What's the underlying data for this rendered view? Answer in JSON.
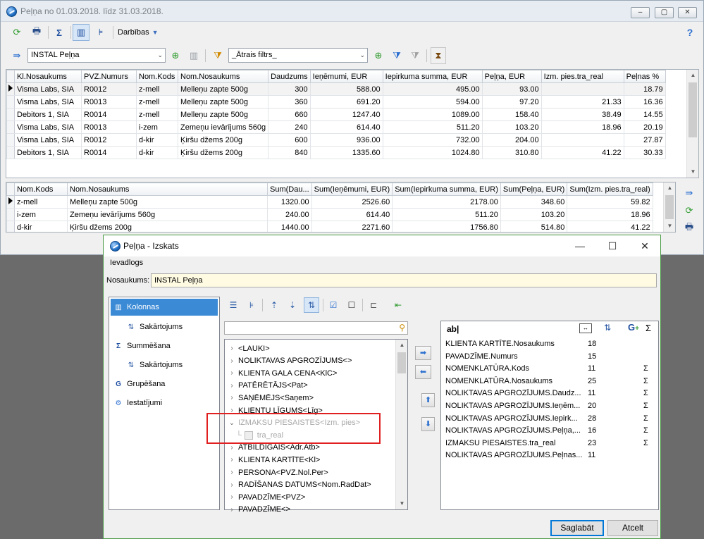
{
  "main_window": {
    "title": "Peļņa no 01.03.2018. līdz 31.03.2018.",
    "toolbar": {
      "actions_label": "Darbības",
      "help_label": "?"
    },
    "view_combo": {
      "value": "INSTAL Peļņa"
    },
    "filter_combo": {
      "value": "_Ātrais filtrs_"
    },
    "detail_grid": {
      "columns": [
        "Kl.Nosaukums",
        "PVZ.Numurs",
        "Nom.Kods",
        "Nom.Nosaukums",
        "Daudzums",
        "Ieņēmumi, EUR",
        "Iepirkuma summa, EUR",
        "Peļņa, EUR",
        "Izm. pies.tra_real",
        "Peļnas %"
      ],
      "rows": [
        [
          "Visma Labs, SIA",
          "R0012",
          "z-mell",
          "Melleņu zapte 500g",
          "300",
          "588.00",
          "495.00",
          "93.00",
          "",
          "18.79"
        ],
        [
          "Visma Labs, SIA",
          "R0013",
          "z-mell",
          "Melleņu zapte 500g",
          "360",
          "691.20",
          "594.00",
          "97.20",
          "21.33",
          "16.36"
        ],
        [
          "Debitors 1, SIA",
          "R0014",
          "z-mell",
          "Melleņu zapte 500g",
          "660",
          "1247.40",
          "1089.00",
          "158.40",
          "38.49",
          "14.55"
        ],
        [
          "Visma Labs, SIA",
          "R0013",
          "i-zem",
          "Zemeņu ievārījums 560g",
          "240",
          "614.40",
          "511.20",
          "103.20",
          "18.96",
          "20.19"
        ],
        [
          "Visma Labs, SIA",
          "R0012",
          "d-kir",
          "Ķiršu džems 200g",
          "600",
          "936.00",
          "732.00",
          "204.00",
          "",
          "27.87"
        ],
        [
          "Debitors 1, SIA",
          "R0014",
          "d-kir",
          "Ķiršu džems 200g",
          "840",
          "1335.60",
          "1024.80",
          "310.80",
          "41.22",
          "30.33"
        ]
      ]
    },
    "summary_grid": {
      "columns": [
        "Nom.Kods",
        "Nom.Nosaukums",
        "Sum(Dau...",
        "Sum(Ieņēmumi, EUR)",
        "Sum(Iepirkuma summa, EUR)",
        "Sum(Peļņa, EUR)",
        "Sum(Izm. pies.tra_real)"
      ],
      "rows": [
        [
          "z-mell",
          "Melleņu zapte 500g",
          "1320.00",
          "2526.60",
          "2178.00",
          "348.60",
          "59.82"
        ],
        [
          "i-zem",
          "Zemeņu ievārījums 560g",
          "240.00",
          "614.40",
          "511.20",
          "103.20",
          "18.96"
        ],
        [
          "d-kir",
          "Ķiršu džems 200g",
          "1440.00",
          "2271.60",
          "1756.80",
          "514.80",
          "41.22"
        ]
      ]
    }
  },
  "dialog": {
    "title": "Peļņa - Izskats",
    "section_label": "Ievadlogs",
    "name_label": "Nosaukums:",
    "name_value": "INSTAL Peļņa",
    "nav": [
      {
        "label": "Kolonnas"
      },
      {
        "label": "Sakārtojums"
      },
      {
        "label": "Summēšana"
      },
      {
        "label": "Sakārtojums"
      },
      {
        "label": "Grupēšana"
      },
      {
        "label": "Iestatījumi"
      }
    ],
    "tree": [
      "<LAUKI>",
      "NOLIKTAVAS APGROZĪJUMS<>",
      "KLIENTA GALA CENA<KlC>",
      "PATĒRĒTĀJS<Pat>",
      "SAŅĒMĒJS<Saņem>",
      "KLIENTU LĪGUMS<Līg>",
      "IZMAKSU PIESAISTES<Izm. pies>",
      "tra_real",
      "ATBILDĪGAIS<Adr.Atb>",
      "KLIENTA KARTĪTE<Kl>",
      "PERSONA<PVZ.Nol.Per>",
      "RADĪŠANAS DATUMS<Nom.RadDat>",
      "PAVADZĪME<PVZ>",
      "PAVADZĪME<>"
    ],
    "selected_list": {
      "header_text": "ab|",
      "header_sigma": "Σ",
      "rows": [
        {
          "name": "KLIENTA KARTĪTE.Nosaukums",
          "width": "18",
          "sum": ""
        },
        {
          "name": "PAVADZĪME.Numurs",
          "width": "15",
          "sum": ""
        },
        {
          "name": "NOMENKLATŪRA.Kods",
          "width": "11",
          "sum": "Σ"
        },
        {
          "name": "NOMENKLATŪRA.Nosaukums",
          "width": "25",
          "sum": "Σ"
        },
        {
          "name": "NOLIKTAVAS APGROZĪJUMS.Daudz...",
          "width": "11",
          "sum": "Σ"
        },
        {
          "name": "NOLIKTAVAS APGROZĪJUMS.Ieņēm...",
          "width": "20",
          "sum": "Σ"
        },
        {
          "name": "NOLIKTAVAS APGROZĪJUMS.Iepirk...",
          "width": "28",
          "sum": "Σ"
        },
        {
          "name": "NOLIKTAVAS APGROZĪJUMS.Peļņa,...",
          "width": "16",
          "sum": "Σ"
        },
        {
          "name": "IZMAKSU PIESAISTES.tra_real",
          "width": "23",
          "sum": "Σ"
        },
        {
          "name": "NOLIKTAVAS APGROZĪJUMS.Peļnas...",
          "width": "11",
          "sum": ""
        }
      ]
    },
    "buttons": {
      "save": "Saglabāt",
      "cancel": "Atcelt"
    },
    "colors": {
      "highlight_box": "#e02020",
      "nav_active": "#3b8ad6",
      "name_field_bg": "#fffbe3"
    }
  }
}
